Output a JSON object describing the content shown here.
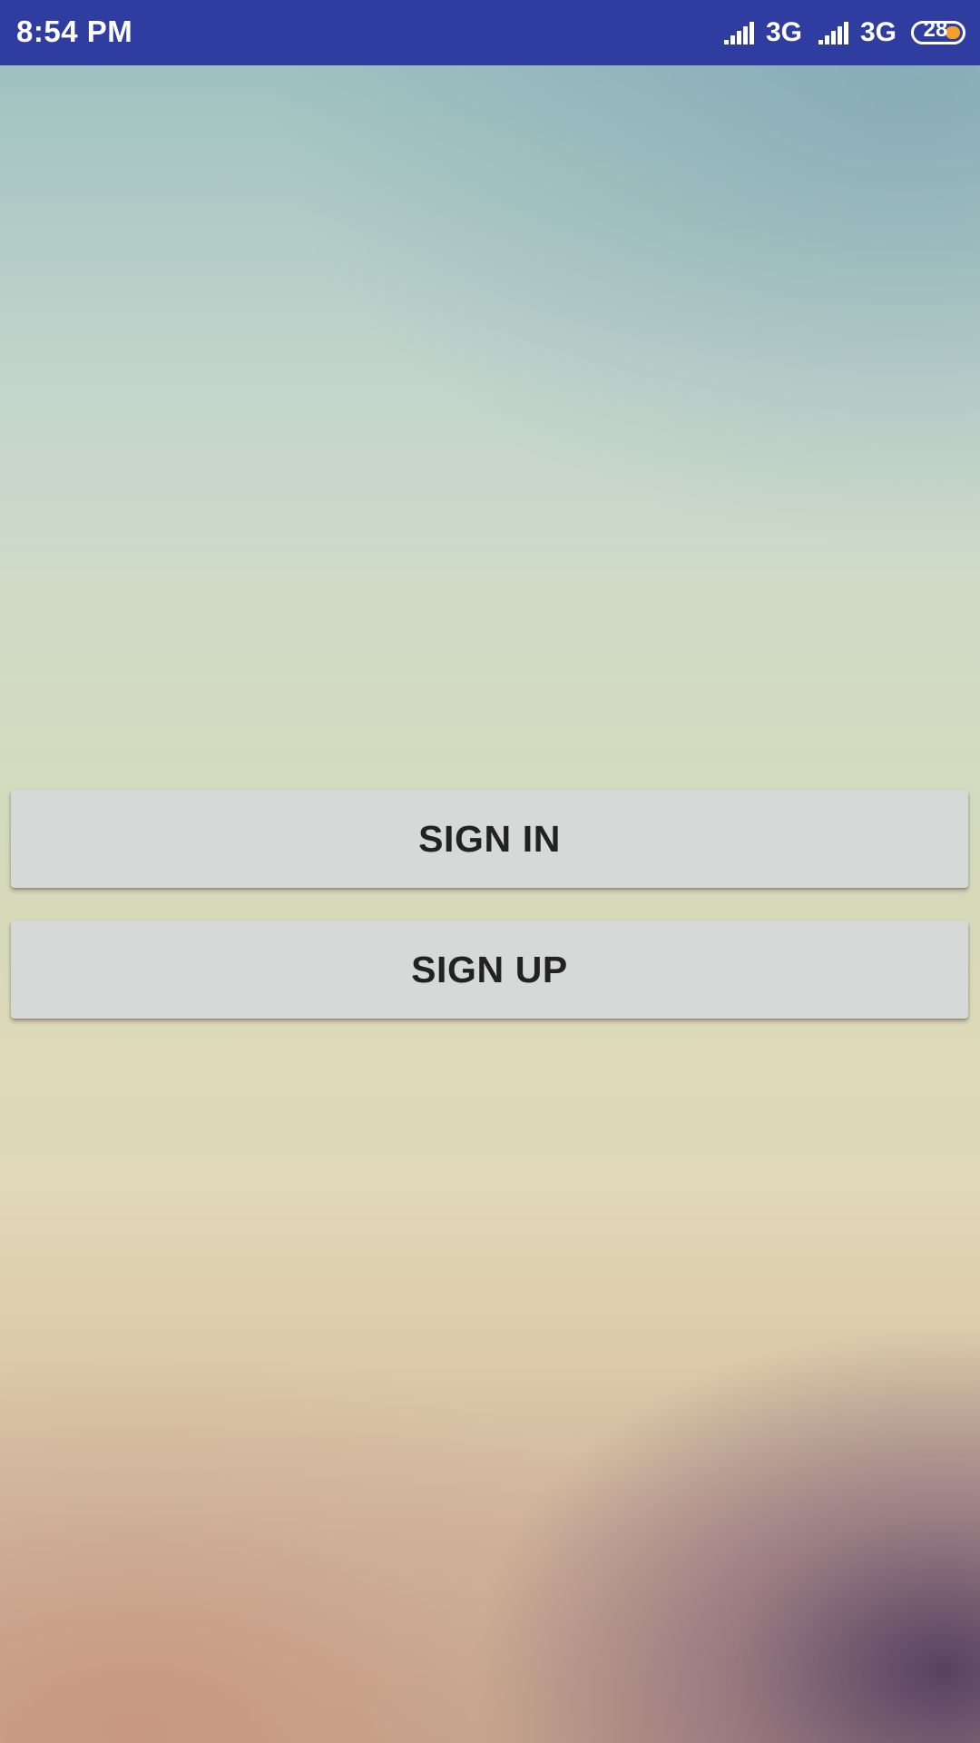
{
  "status_bar": {
    "time": "8:54 PM",
    "network_1": "3G",
    "network_2": "3G",
    "battery_level": "28",
    "background_color": "#2e3d9f",
    "battery_indicator_color": "#f2a22a"
  },
  "buttons": {
    "sign_in": "SIGN IN",
    "sign_up": "SIGN UP"
  }
}
